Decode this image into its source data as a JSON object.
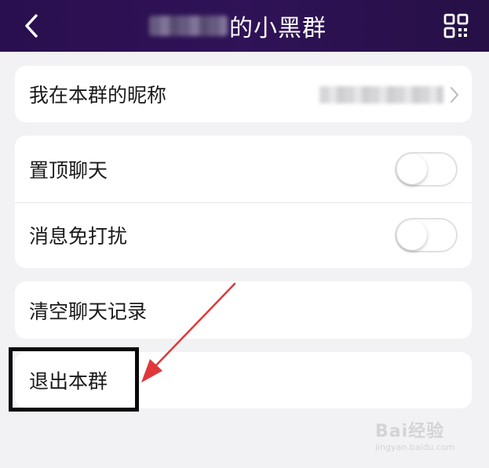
{
  "header": {
    "title": "的小黑群",
    "back_icon": "chevron-left-icon",
    "qr_icon": "qr-code-icon",
    "gradient": [
      "#2a0f4f",
      "#261046"
    ]
  },
  "settings": {
    "nickname_label": "我在本群的昵称",
    "pin_chat_label": "置顶聊天",
    "pin_chat_on": false,
    "do_not_disturb_label": "消息免打扰",
    "do_not_disturb_on": false,
    "clear_history_label": "清空聊天记录",
    "exit_group_label": "退出本群"
  },
  "annotation": {
    "arrow_color": "#e0383a",
    "box_color": "#0a0a0a"
  },
  "watermark": {
    "main": "Bai经验",
    "sub": "jingyan.baidu.com"
  }
}
